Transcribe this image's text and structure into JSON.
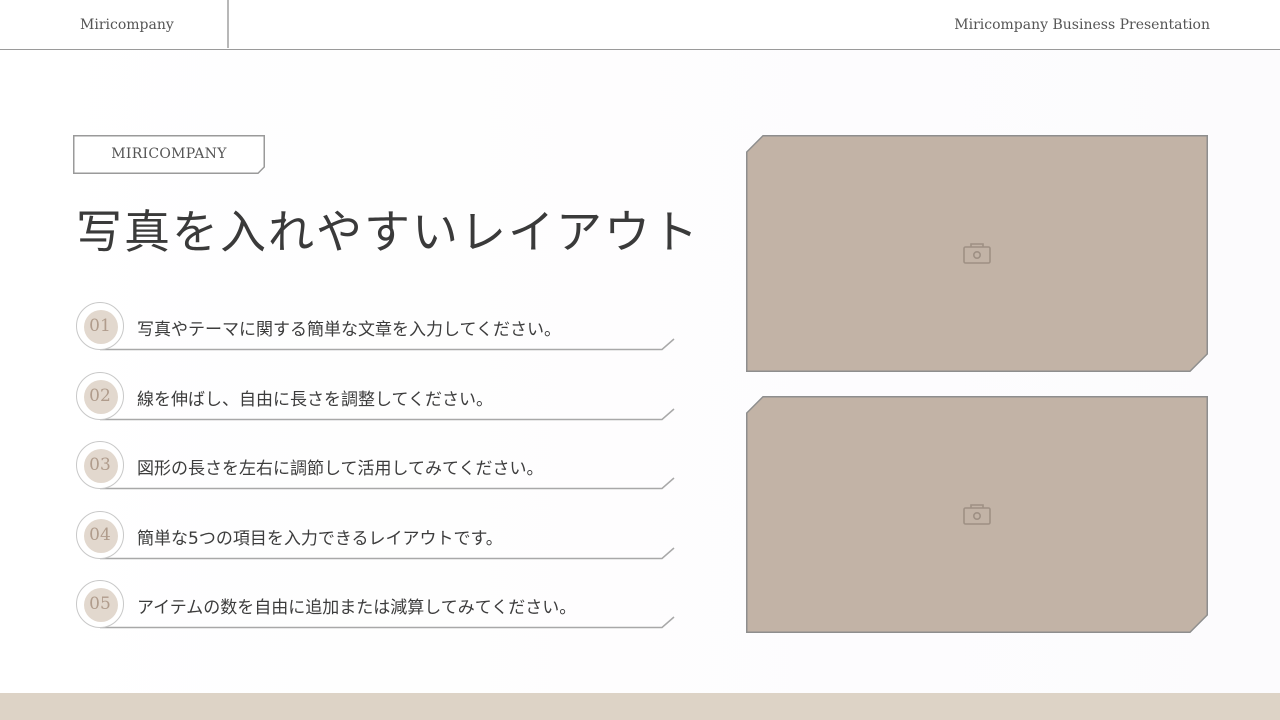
{
  "header": {
    "company": "Miricompany",
    "presentation_title": "Miricompany Business Presentation"
  },
  "tag": "MIRICOMPANY",
  "title": "写真を入れやすいレイアウト",
  "items": [
    {
      "number": "01",
      "text": "写真やテーマに関する簡単な文章を入力してください。"
    },
    {
      "number": "02",
      "text": "線を伸ばし、自由に長さを調整してください。"
    },
    {
      "number": "03",
      "text": "図形の長さを左右に調節して活用してみてください。"
    },
    {
      "number": "04",
      "text": "簡単な5つの項目を入力できるレイアウトです。"
    },
    {
      "number": "05",
      "text": "アイテムの数を自由に追加または減算してみてください。"
    }
  ],
  "photos": [
    {
      "icon": "camera-icon"
    },
    {
      "icon": "camera-icon"
    }
  ],
  "colors": {
    "accent_beige": "#ddd3c6",
    "photo_fill": "#c2b3a6",
    "number_color": "#b09c8c"
  }
}
